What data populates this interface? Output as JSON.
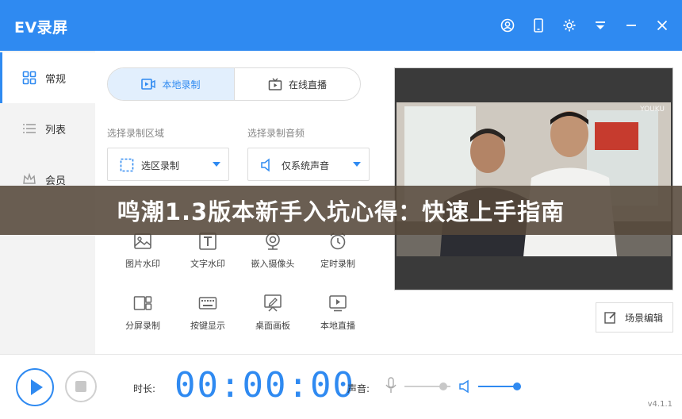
{
  "app": {
    "title": "EV录屏",
    "version": "v4.1.1"
  },
  "titlebar_icons": [
    "user-icon",
    "phone-icon",
    "gear-icon",
    "dropdown-menu-icon",
    "minimize-icon",
    "close-icon"
  ],
  "sidebar": {
    "items": [
      {
        "label": "常规",
        "icon": "grid-icon",
        "active": true
      },
      {
        "label": "列表",
        "icon": "list-icon",
        "active": false
      },
      {
        "label": "会员",
        "icon": "crown-icon",
        "active": false
      }
    ]
  },
  "mode_tabs": [
    {
      "label": "本地录制",
      "icon": "record-icon",
      "active": true
    },
    {
      "label": "在线直播",
      "icon": "tv-icon",
      "active": false
    }
  ],
  "record_area": {
    "label": "选择录制区域",
    "value": "选区录制"
  },
  "record_audio": {
    "label": "选择录制音频",
    "value": "仅系统声音"
  },
  "tools": [
    {
      "label": "图片水印",
      "icon": "image-icon"
    },
    {
      "label": "文字水印",
      "icon": "text-icon"
    },
    {
      "label": "嵌入摄像头",
      "icon": "webcam-icon"
    },
    {
      "label": "定时录制",
      "icon": "alarm-icon"
    },
    {
      "label": "分屏录制",
      "icon": "split-screen-icon"
    },
    {
      "label": "按键显示",
      "icon": "keyboard-icon"
    },
    {
      "label": "桌面画板",
      "icon": "whiteboard-icon"
    },
    {
      "label": "本地直播",
      "icon": "live-icon"
    }
  ],
  "preview": {
    "watermark": "YOUKU"
  },
  "scene_button": {
    "label": "场景编辑"
  },
  "bottom": {
    "duration_label": "时长:",
    "timer": "00:00:00",
    "volume_label": "声音:",
    "mic_level": 0.85,
    "speaker_level": 0.9
  },
  "banner": {
    "text": "鸣潮1.3版本新手入坑心得：快速上手指南"
  },
  "colors": {
    "accent": "#2f8af1",
    "tab_active_bg": "#e2effd",
    "banner_bg": "#55483a"
  }
}
